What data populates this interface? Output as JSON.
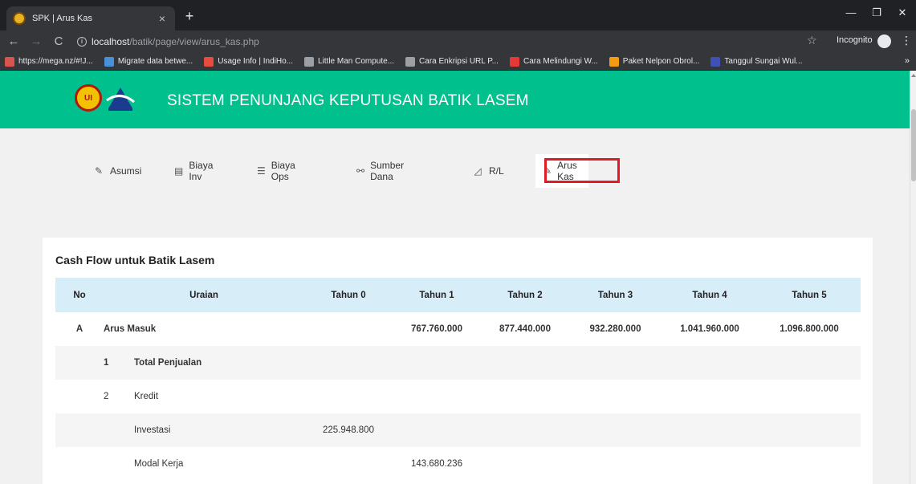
{
  "browser": {
    "tab_title": "SPK | Arus Kas",
    "tab_close": "×",
    "new_tab": "+",
    "url_host": "localhost",
    "url_path": "/batik/page/view/arus_kas.php",
    "incognito_label": "Incognito",
    "window_minimize": "—",
    "window_restore": "❐",
    "window_close": "✕",
    "bookmarks": [
      {
        "label": "https://mega.nz/#!J...",
        "color": "#d9534f"
      },
      {
        "label": "Migrate data betwe...",
        "color": "#4a90d9"
      },
      {
        "label": "Usage Info | IndiHo...",
        "color": "#e74c3c"
      },
      {
        "label": "Little Man Compute...",
        "color": "#9aa0a6"
      },
      {
        "label": "Cara Enkripsi URL P...",
        "color": "#9aa0a6"
      },
      {
        "label": "Cara Melindungi W...",
        "color": "#e53935"
      },
      {
        "label": "Paket Nelpon Obrol...",
        "color": "#f39c12"
      },
      {
        "label": "Tanggul Sungai Wul...",
        "color": "#3f51b5"
      }
    ],
    "bookmarks_more": "»"
  },
  "app": {
    "title": "SISTEM PENUNJANG KEPUTUSAN BATIK LASEM",
    "header_color": "#00c08e",
    "logo1_text": "UI"
  },
  "nav": {
    "items": [
      {
        "label": "Asumsi",
        "icon": "edit-icon",
        "glyph": "✎"
      },
      {
        "label": "Biaya Inv",
        "icon": "clipboard-icon",
        "glyph": "▤"
      },
      {
        "label": "Biaya Ops",
        "icon": "list-circle-icon",
        "glyph": "☰"
      },
      {
        "label": "Sumber Dana",
        "icon": "handshake-icon",
        "glyph": "⚯"
      },
      {
        "label": "R/L",
        "icon": "chart-icon",
        "glyph": "◿"
      },
      {
        "label": "Arus Kas",
        "icon": "paperclip-icon",
        "glyph": "✎",
        "active": true
      }
    ],
    "highlight_color": "#e01b24"
  },
  "card": {
    "title": "Cash Flow untuk Batik Lasem",
    "headers": [
      "No",
      "Uraian",
      "Tahun 0",
      "Tahun 1",
      "Tahun 2",
      "Tahun 3",
      "Tahun 4",
      "Tahun 5"
    ],
    "rows": [
      {
        "no": "A",
        "sub": "",
        "label": "Arus Masuk",
        "bold": true,
        "values": [
          "",
          "767.760.000",
          "877.440.000",
          "932.280.000",
          "1.041.960.000",
          "1.096.800.000"
        ]
      },
      {
        "no": "",
        "sub": "1",
        "label": "Total Penjualan",
        "bold": true,
        "values": [
          "",
          "",
          "",
          "",
          "",
          ""
        ]
      },
      {
        "no": "",
        "sub": "2",
        "label": "Kredit",
        "bold": false,
        "values": [
          "",
          "",
          "",
          "",
          "",
          ""
        ]
      },
      {
        "no": "",
        "sub": "",
        "label": "Investasi",
        "bold": false,
        "values": [
          "225.948.800",
          "",
          "",
          "",
          "",
          ""
        ]
      },
      {
        "no": "",
        "sub": "",
        "label": "Modal Kerja",
        "bold": false,
        "values": [
          "",
          "143.680.236",
          "",
          "",
          "",
          ""
        ]
      }
    ]
  }
}
